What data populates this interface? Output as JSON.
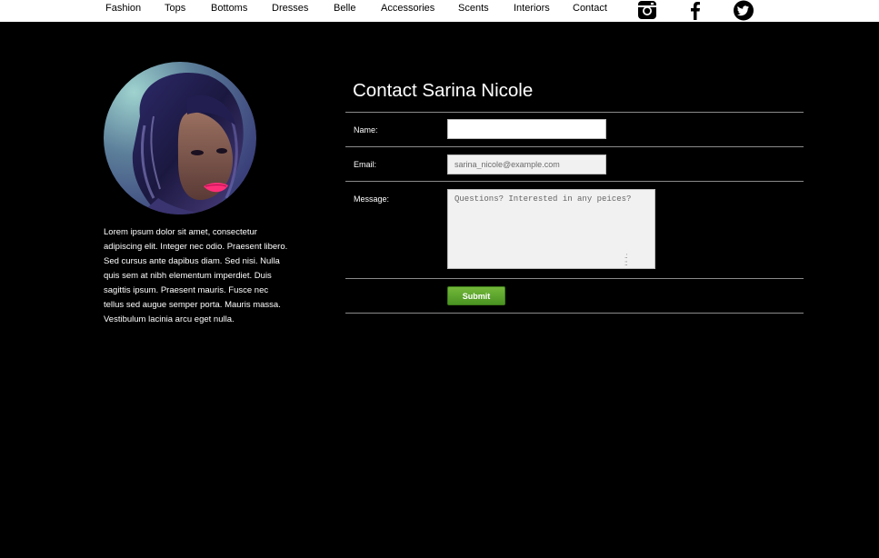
{
  "nav": {
    "items": [
      {
        "label": "Fashion"
      },
      {
        "label": "Tops"
      },
      {
        "label": "Bottoms"
      },
      {
        "label": "Dresses"
      },
      {
        "label": "Belle"
      },
      {
        "label": "Accessories"
      },
      {
        "label": "Scents"
      },
      {
        "label": "Interiors"
      },
      {
        "label": "Contact"
      }
    ],
    "social": [
      "instagram-icon",
      "facebook-icon",
      "twitter-icon"
    ]
  },
  "profile": {
    "bio": "Lorem ipsum dolor sit amet, consectetur adipiscing elit. Integer nec odio. Praesent libero. Sed cursus ante dapibus diam. Sed nisi. Nulla quis sem at nibh elementum imperdiet. Duis sagittis ipsum. Praesent mauris. Fusce nec tellus sed augue semper porta. Mauris massa. Vestibulum lacinia arcu eget nulla."
  },
  "contact": {
    "title": "Contact Sarina Nicole",
    "name_label": "Name:",
    "name_value": "",
    "email_label": "Email:",
    "email_placeholder": "sarina_nicole@example.com",
    "message_label": "Message:",
    "message_placeholder": "Questions? Interested in any peices?",
    "submit_label": "Submit"
  },
  "colors": {
    "background": "#000000",
    "topbar": "#ffffff",
    "rule": "#8a8a8a",
    "submit": "#5ba52c"
  }
}
